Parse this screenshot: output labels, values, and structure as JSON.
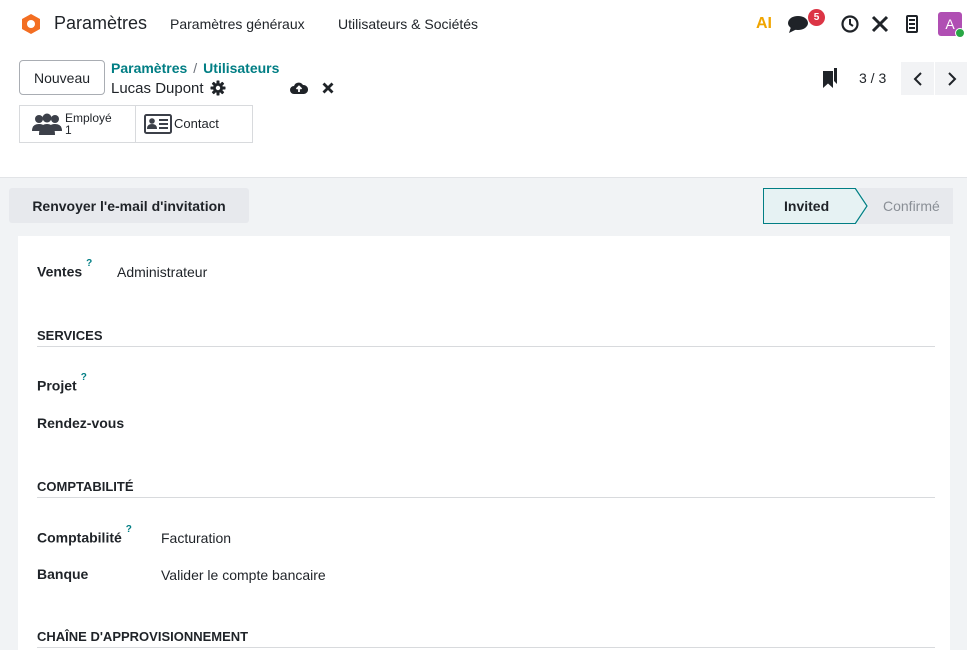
{
  "navbar": {
    "app_name": "Paramètres",
    "menu": [
      "Paramètres généraux",
      "Utilisateurs & Sociétés"
    ],
    "ai_label": "AI",
    "messages_count": "5",
    "avatar_letter": "A",
    "icons": [
      "odoo-logo-icon",
      "ai-icon",
      "chat-icon",
      "clock-icon",
      "tools-icon",
      "phone-icon",
      "avatar"
    ]
  },
  "control_panel": {
    "new_button": "Nouveau",
    "breadcrumb": {
      "parent": "Paramètres",
      "separator": "/",
      "current": "Utilisateurs"
    },
    "record_name": "Lucas Dupont",
    "pager": {
      "value": "3 / 3"
    }
  },
  "smart_buttons": [
    {
      "label": "Employé",
      "value": "1",
      "icon": "employees-icon"
    },
    {
      "label": "Contact",
      "icon": "contact-card-icon"
    }
  ],
  "statusbar": {
    "resend_button": "Renvoyer l'e-mail d'invitation",
    "stages": [
      {
        "label": "Invited",
        "active": true
      },
      {
        "label": "Confirmé",
        "active": false
      }
    ]
  },
  "form": {
    "sales": {
      "label": "Ventes",
      "help": "?",
      "value": "Administrateur"
    },
    "services_title": "SERVICES",
    "project": {
      "label": "Projet",
      "help": "?"
    },
    "appointments": {
      "label": "Rendez-vous"
    },
    "accounting_title": "COMPTABILITÉ",
    "accounting": {
      "label": "Comptabilité",
      "help": "?",
      "value": "Facturation"
    },
    "bank": {
      "label": "Banque",
      "value": "Valider le compte bancaire"
    },
    "supply_title": "CHAÎNE D'APPROVISIONNEMENT"
  },
  "colors": {
    "accent": "#017e84",
    "badge": "#dc3545",
    "avatar": "#b04fb3",
    "logo_orange": "#f36e22",
    "online": "#28a745"
  }
}
